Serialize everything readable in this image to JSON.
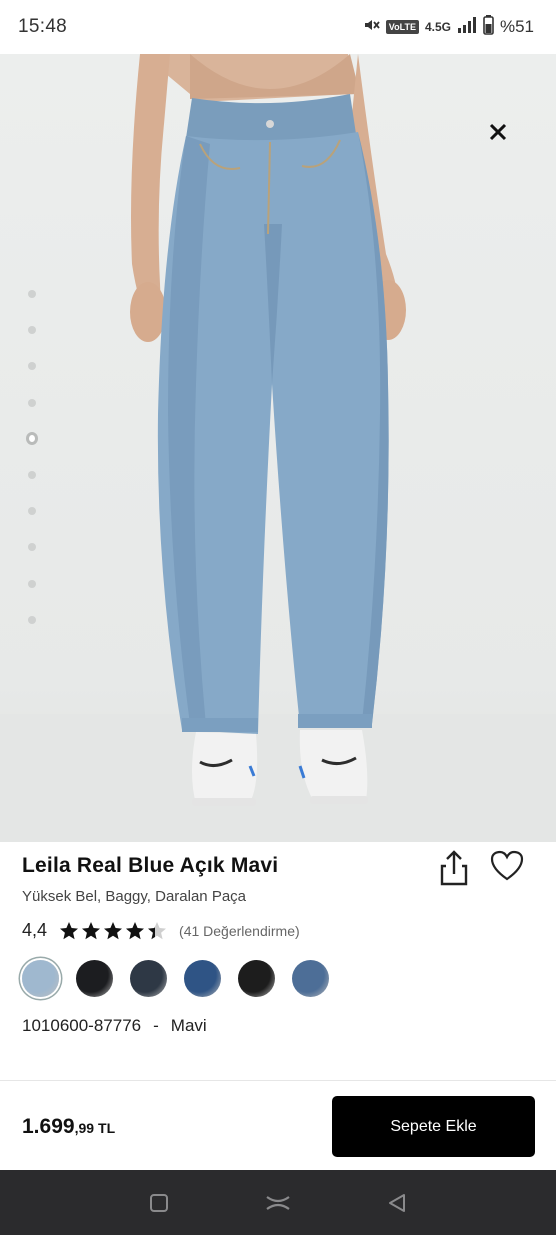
{
  "status_bar": {
    "time": "15:48",
    "volte": "VoLTE",
    "network": "4.5G",
    "battery": "%51",
    "icons": [
      "mute-icon",
      "signal-icon",
      "battery-icon"
    ]
  },
  "product": {
    "image_alt_icon": "product-photo-jeans",
    "gallery_total": 10,
    "gallery_active_index": 4,
    "title": "Leila Real Blue Açık Mavi",
    "subtitle": "Yüksek Bel, Baggy, Daralan Paça",
    "rating": "4,4",
    "rating_value": 4.4,
    "rating_max": 5,
    "reviews": "(41 Değerlendirme)",
    "swatches": [
      {
        "color": "#9fb8cf",
        "selected": true
      },
      {
        "color": "#1c1d20"
      },
      {
        "color": "#2e3845"
      },
      {
        "color": "#2f5485"
      },
      {
        "color": "#1d1d1d"
      },
      {
        "color": "#4d6e97"
      }
    ],
    "sku": "1010600-87776",
    "separator": "-",
    "color_name": "Mavi"
  },
  "purchase": {
    "price_main": "1.699",
    "price_decimal": ",99",
    "currency": "TL",
    "cart_label": "Sepete Ekle"
  },
  "colors": {
    "accent": "#000000",
    "star": "#111111",
    "nav_bg": "#2b2b2d"
  }
}
